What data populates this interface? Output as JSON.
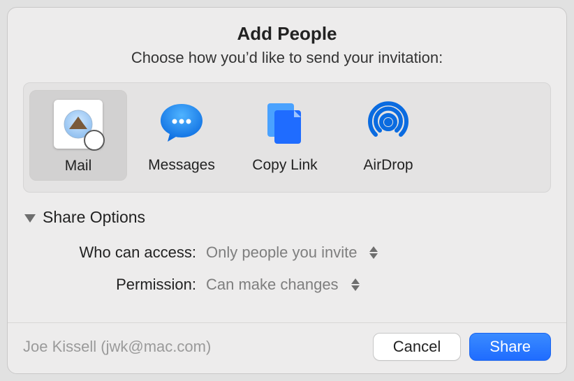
{
  "header": {
    "title": "Add People",
    "subtitle": "Choose how you’d like to send your invitation:"
  },
  "share": {
    "items": [
      {
        "id": "mail",
        "label": "Mail",
        "selected": true
      },
      {
        "id": "messages",
        "label": "Messages",
        "selected": false
      },
      {
        "id": "copy-link",
        "label": "Copy Link",
        "selected": false
      },
      {
        "id": "airdrop",
        "label": "AirDrop",
        "selected": false
      }
    ]
  },
  "options": {
    "header": "Share Options",
    "access_label": "Who can access:",
    "access_value": "Only people you invite",
    "permission_label": "Permission:",
    "permission_value": "Can make changes"
  },
  "footer": {
    "status": "Joe Kissell (jwk@mac.com)",
    "cancel": "Cancel",
    "share": "Share"
  }
}
